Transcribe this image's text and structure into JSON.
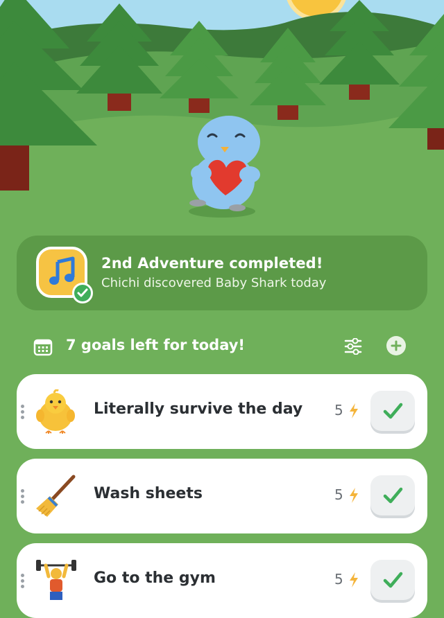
{
  "adventure": {
    "title": "2nd Adventure completed!",
    "subtitle": "Chichi discovered Baby Shark today",
    "badge_icon": "music-note-icon",
    "badge_color": "#f6c343",
    "check_color": "#3fae5a"
  },
  "goals": {
    "header": "7 goals left for today!",
    "icons": [
      "calendar-icon",
      "filter-icon",
      "add-icon"
    ]
  },
  "tasks": [
    {
      "label": "Literally survive the day",
      "points": "5",
      "icon": "baby-chick-icon"
    },
    {
      "label": "Wash sheets",
      "points": "5",
      "icon": "broom-icon"
    },
    {
      "label": "Go to the gym",
      "points": "5",
      "icon": "weightlifter-icon"
    }
  ],
  "colors": {
    "background": "#6fb05a",
    "card": "#ffffff",
    "bolt": "#f4b43b",
    "check": "#3fae5a"
  }
}
